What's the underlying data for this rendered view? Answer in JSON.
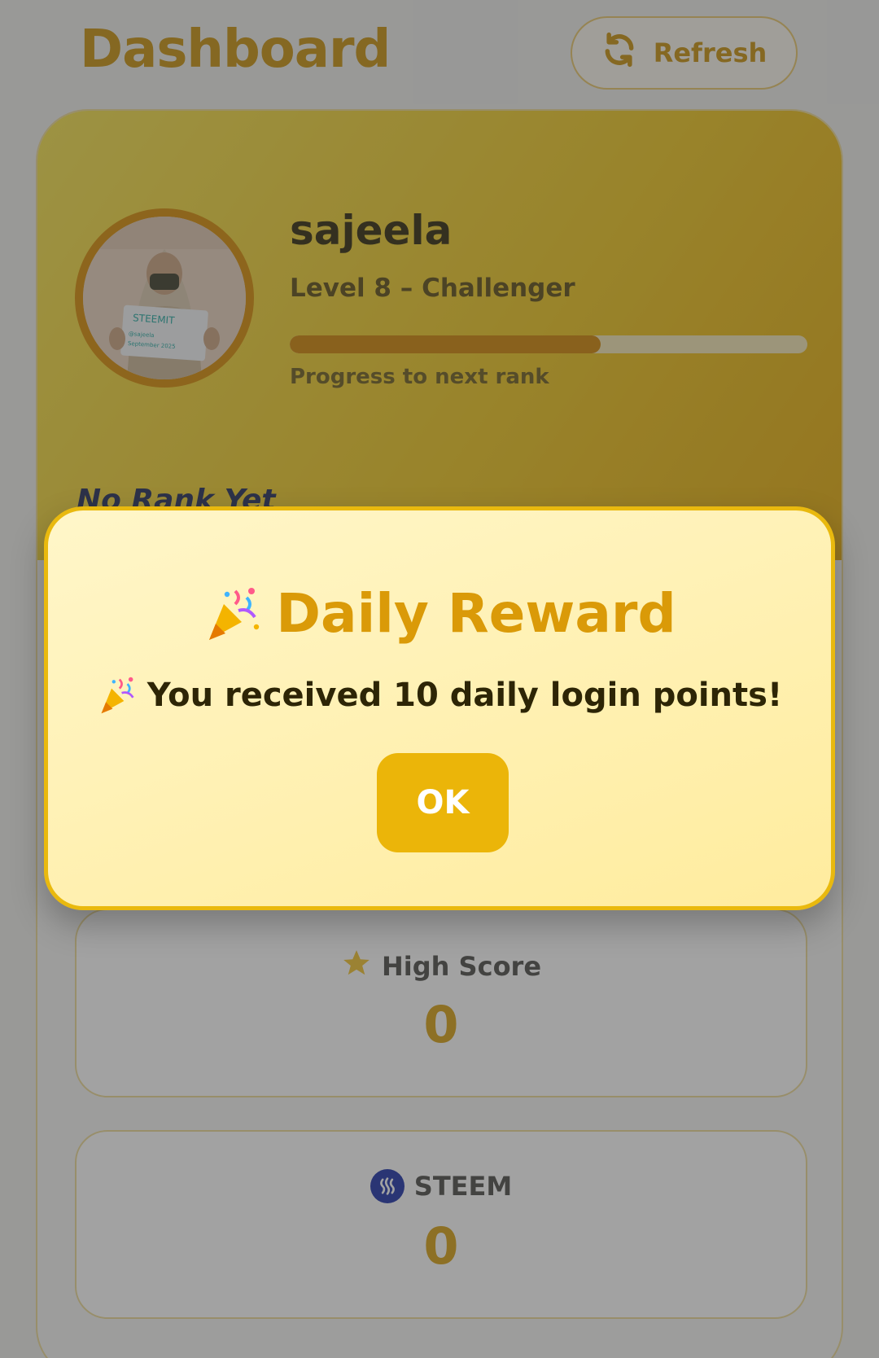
{
  "header": {
    "title": "Dashboard",
    "refresh_label": "Refresh"
  },
  "profile": {
    "username": "sajeela",
    "level": "Level 8 – Challenger",
    "progress_label": "Progress to next rank",
    "progress_fraction": 0.6,
    "rank": "No Rank Yet",
    "avatar_sign": {
      "line1": "STEEMIT",
      "line2": "@sajeela",
      "line3": "September 2025"
    }
  },
  "stats": [
    {
      "label": "High Score",
      "value": "0",
      "icon": "star-icon"
    },
    {
      "label": "STEEM",
      "value": "0",
      "icon": "steem-logo-icon"
    }
  ],
  "modal": {
    "title": "Daily Reward",
    "message": "You received 10 daily login points!",
    "ok_label": "OK",
    "icon": "party-popper-icon"
  },
  "colors": {
    "accent": "#e9b90e",
    "title_gold": "#c7900a",
    "progress_fill": "#d08300"
  }
}
